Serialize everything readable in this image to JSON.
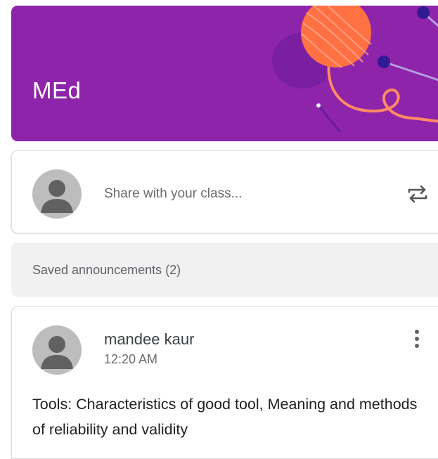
{
  "banner": {
    "title": "MEd",
    "color": "#8e24aa",
    "illustration": "yarn-ball-knitting-needles"
  },
  "share_box": {
    "placeholder": "Share with your class...",
    "avatar_icon": "default-avatar-icon",
    "action_icon": "repost-icon"
  },
  "saved": {
    "label": "Saved announcements (2)"
  },
  "post": {
    "author": "mandee kaur",
    "time": "12:20 AM",
    "body": "Tools: Characteristics of good tool, Meaning and methods of reliability and validity",
    "menu_icon": "more-vertical-icon"
  }
}
